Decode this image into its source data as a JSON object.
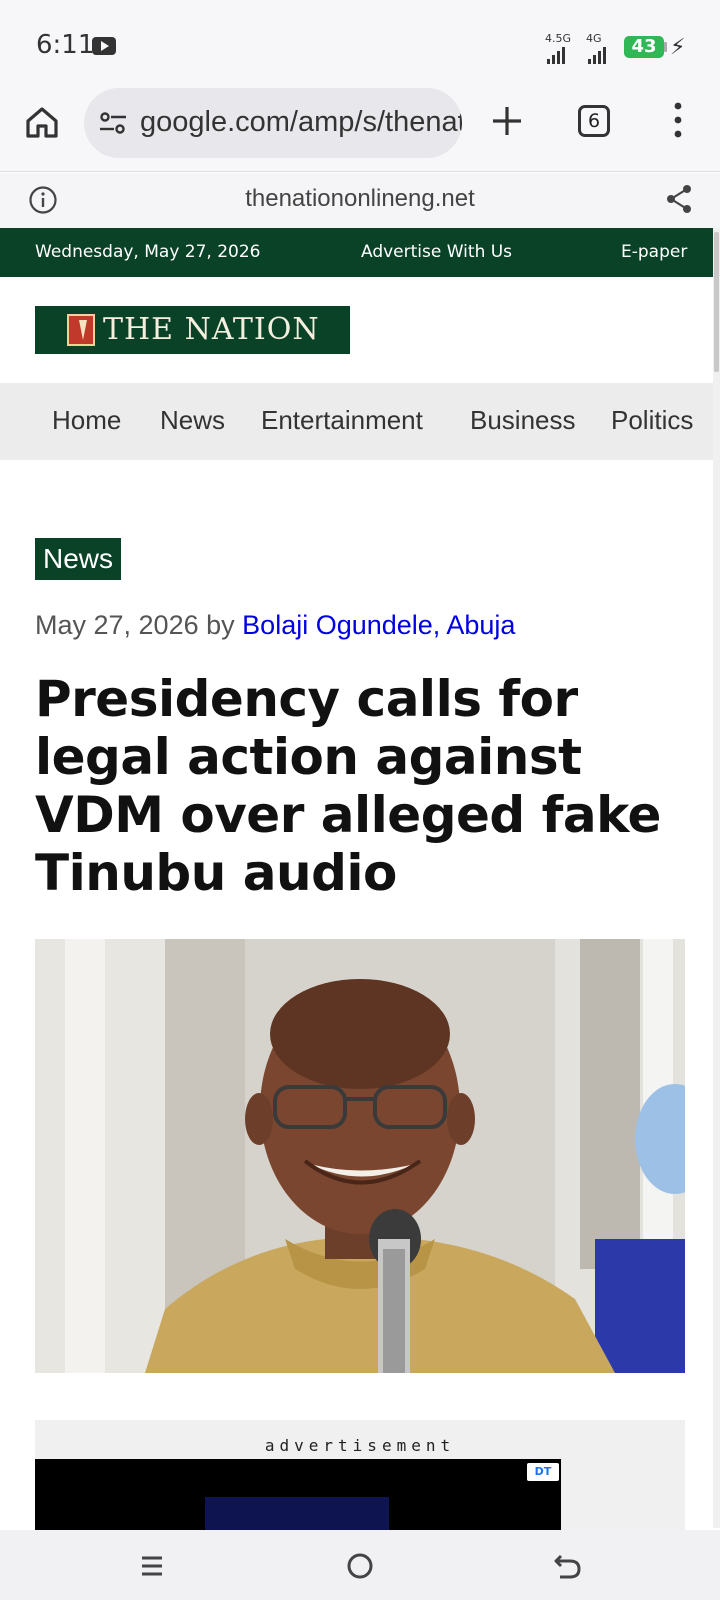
{
  "status_bar": {
    "time": "6:11",
    "signal1_label": "4.5G",
    "signal2_label": "4G",
    "battery_level": "43"
  },
  "browser": {
    "url": "google.com/amp/s/thenationonlineng.net",
    "tab_count": "6",
    "amp_domain": "thenationonlineng.net"
  },
  "top_bar": {
    "date": "Wednesday, May 27, 2026",
    "advertise": "Advertise With Us",
    "epaper": "E-paper"
  },
  "logo": {
    "text": "THE NATION"
  },
  "nav": {
    "items": [
      "Home",
      "News",
      "Entertainment",
      "Business",
      "Politics"
    ]
  },
  "article": {
    "category": "News",
    "date": "May 27, 2026",
    "by": "by",
    "author": "Bolaji Ogundele, Abuja",
    "headline": "Presidency calls for legal action against VDM over alleged fake Tinubu audio"
  },
  "ad": {
    "label": "advertisement",
    "badge": "DT"
  },
  "colors": {
    "brand_green": "#0a4227",
    "link_blue": "#0000e0",
    "battery_green": "#2fb855"
  }
}
